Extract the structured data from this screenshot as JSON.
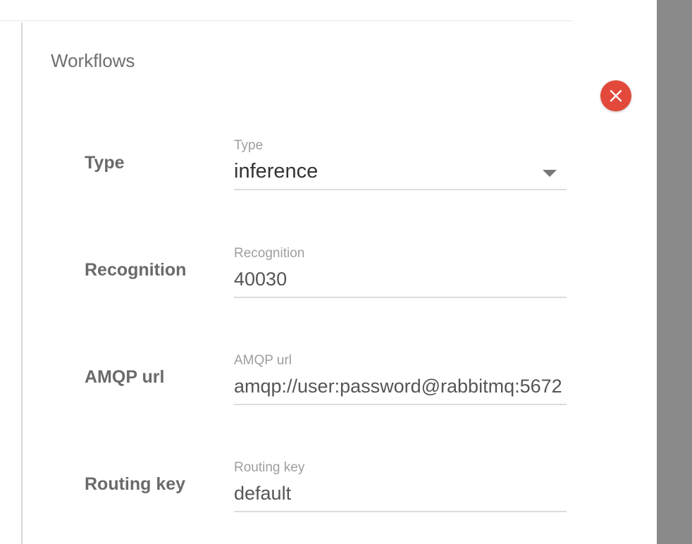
{
  "section": {
    "title": "Workflows"
  },
  "actions": {
    "remove_icon": "close-icon",
    "remove_color": "#e2493b"
  },
  "fields": {
    "type": {
      "row_label": "Type",
      "float_label": "Type",
      "value": "inference",
      "icon": "dropdown-arrow-icon"
    },
    "recognition": {
      "row_label": "Recognition",
      "float_label": "Recognition",
      "value": "40030"
    },
    "amqp_url": {
      "row_label": "AMQP url",
      "float_label": "AMQP url",
      "value": "amqp://user:password@rabbitmq:5672"
    },
    "routing_key": {
      "row_label": "Routing key",
      "float_label": "Routing key",
      "value": "default"
    }
  }
}
